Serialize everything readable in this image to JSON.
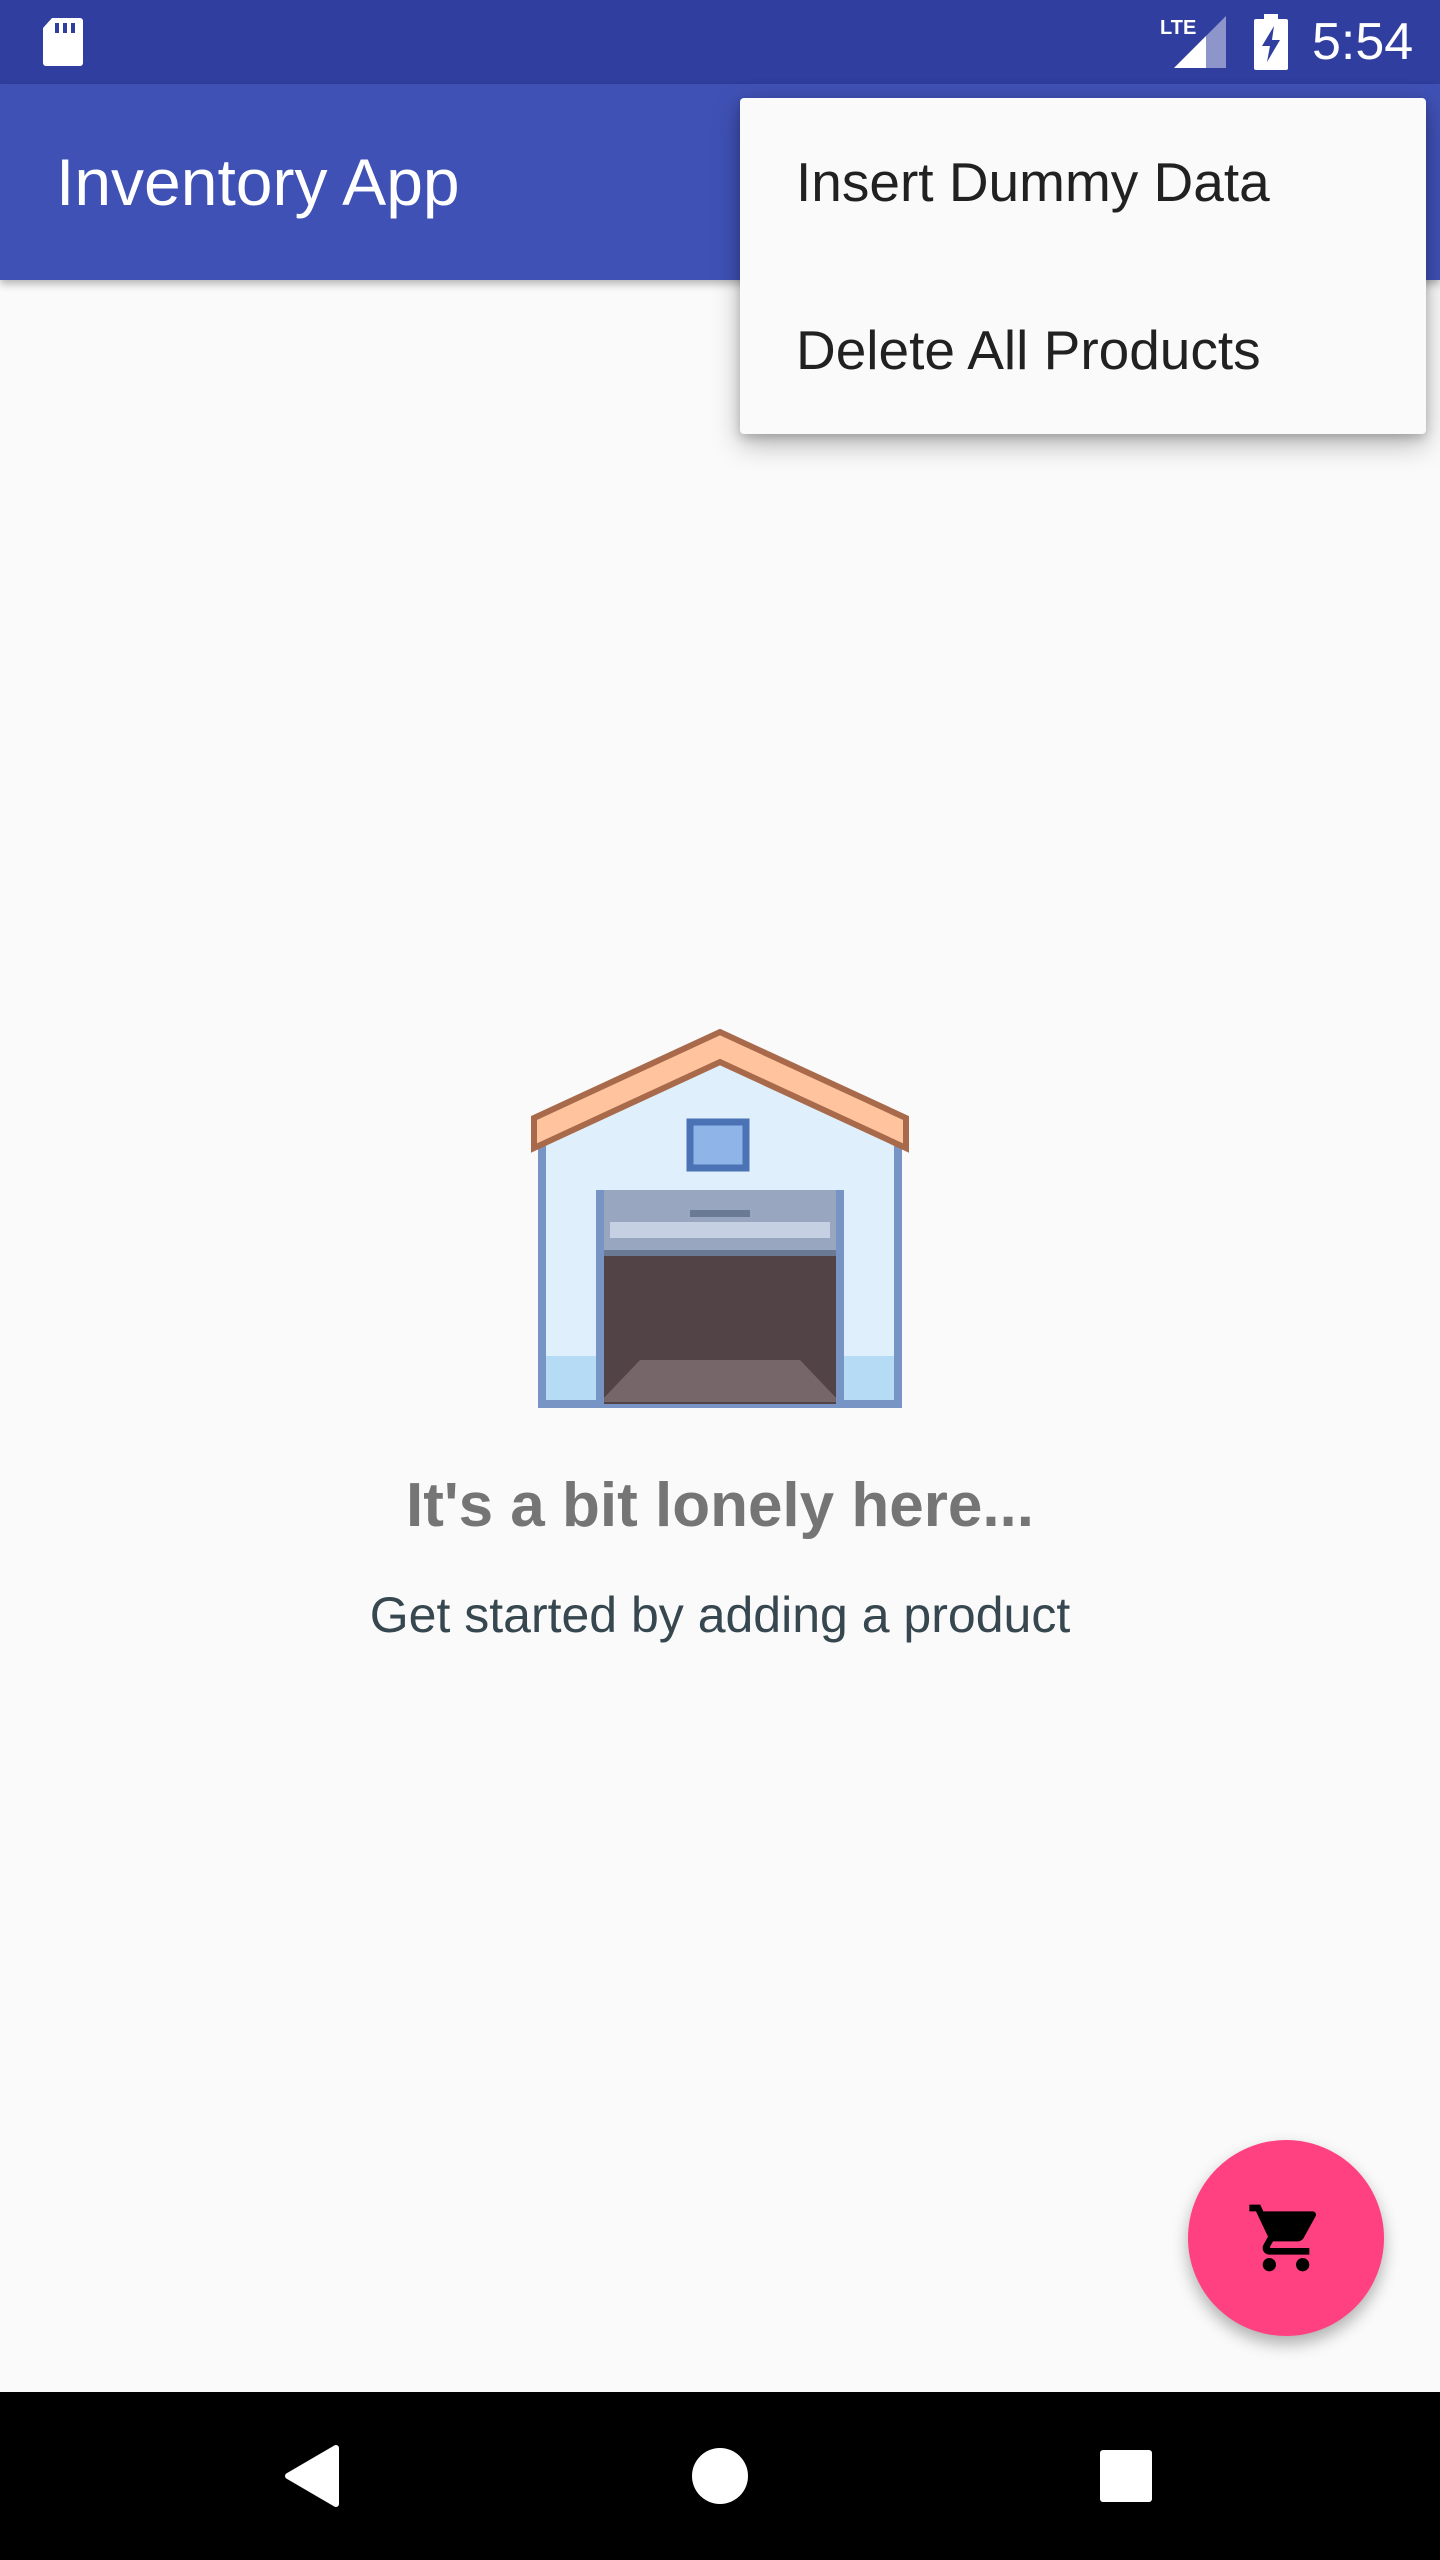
{
  "status_bar": {
    "time": "5:54",
    "network_label": "LTE",
    "icons": [
      "sd-card-icon",
      "lte-signal-icon",
      "battery-charging-icon"
    ]
  },
  "app_bar": {
    "title": "Inventory App"
  },
  "overflow_menu": {
    "items": [
      {
        "label": "Insert Dummy Data"
      },
      {
        "label": "Delete All Products"
      }
    ]
  },
  "empty_state": {
    "illustration": "warehouse-icon",
    "title": "It's a bit lonely here...",
    "subtitle": "Get started by adding a product"
  },
  "fab": {
    "icon": "shopping-cart-icon"
  },
  "nav_bar": {
    "icons": [
      "back-icon",
      "home-icon",
      "recents-icon"
    ]
  },
  "colors": {
    "status_bar": "#303f9f",
    "primary": "#3f51b5",
    "accent": "#ff4081",
    "background": "#fafafa",
    "empty_title": "#757575",
    "empty_subtitle": "#37474f"
  }
}
